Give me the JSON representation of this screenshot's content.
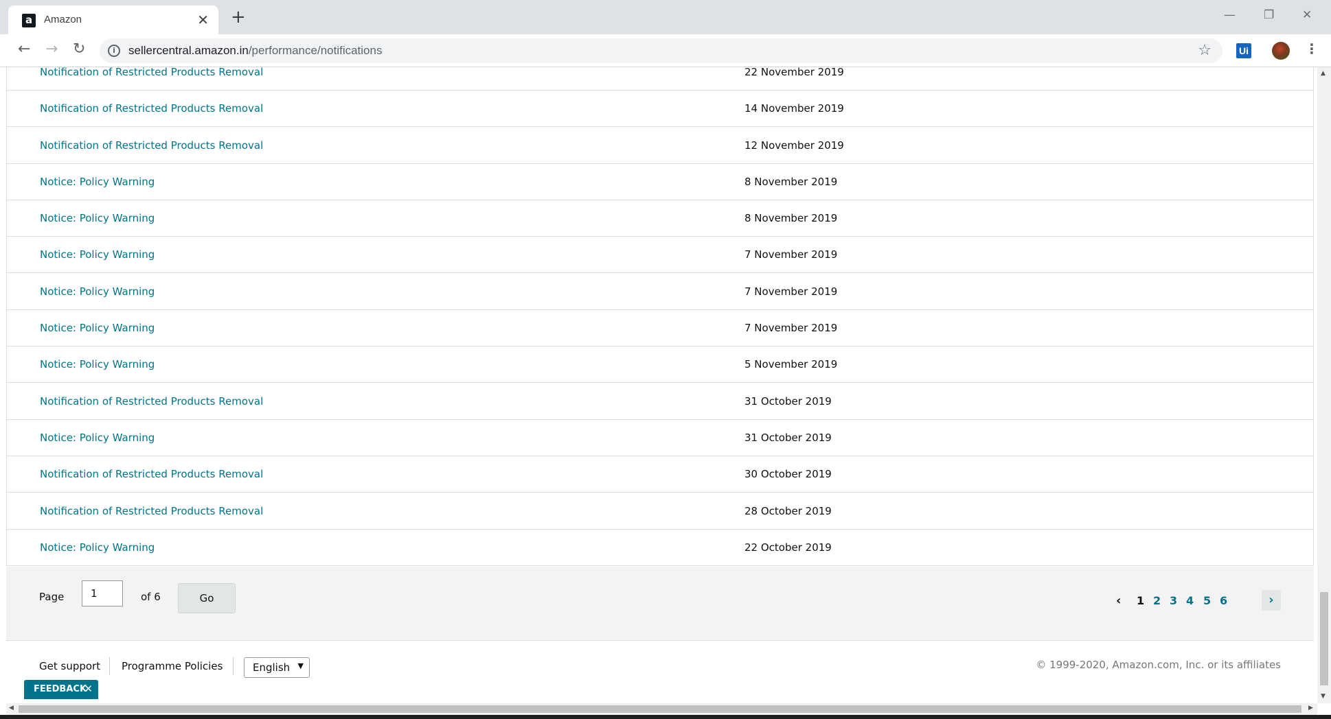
{
  "browser": {
    "tab_title": "Amazon",
    "favicon_letter": "a",
    "url_domain": "sellercentral.amazon.in",
    "url_path": "/performance/notifications",
    "extension_label": "Ui"
  },
  "notifications": [
    {
      "title": "Notification of Restricted Products Removal",
      "date": "22 November 2019"
    },
    {
      "title": "Notification of Restricted Products Removal",
      "date": "14 November 2019"
    },
    {
      "title": "Notification of Restricted Products Removal",
      "date": "12 November 2019"
    },
    {
      "title": "Notice: Policy Warning",
      "date": "8 November 2019"
    },
    {
      "title": "Notice: Policy Warning",
      "date": "8 November 2019"
    },
    {
      "title": "Notice: Policy Warning",
      "date": "7 November 2019"
    },
    {
      "title": "Notice: Policy Warning",
      "date": "7 November 2019"
    },
    {
      "title": "Notice: Policy Warning",
      "date": "7 November 2019"
    },
    {
      "title": "Notice: Policy Warning",
      "date": "5 November 2019"
    },
    {
      "title": "Notification of Restricted Products Removal",
      "date": "31 October 2019"
    },
    {
      "title": "Notice: Policy Warning",
      "date": "31 October 2019"
    },
    {
      "title": "Notification of Restricted Products Removal",
      "date": "30 October 2019"
    },
    {
      "title": "Notification of Restricted Products Removal",
      "date": "28 October 2019"
    },
    {
      "title": "Notice: Policy Warning",
      "date": "22 October 2019"
    }
  ],
  "pagination": {
    "page_label": "Page",
    "current_value": "1",
    "of_label": "of 6",
    "go_label": "Go",
    "pages": [
      "1",
      "2",
      "3",
      "4",
      "5",
      "6"
    ],
    "current_page": "1"
  },
  "footer": {
    "support_label": "Get support",
    "policies_label": "Programme Policies",
    "language": "English",
    "copyright": "© 1999-2020, Amazon.com, Inc. or its affiliates"
  },
  "feedback_label": "FEEDBACK",
  "colors": {
    "link": "#00748a",
    "pager_bg": "#f3f3f3",
    "feedback_bg": "#00748a"
  }
}
